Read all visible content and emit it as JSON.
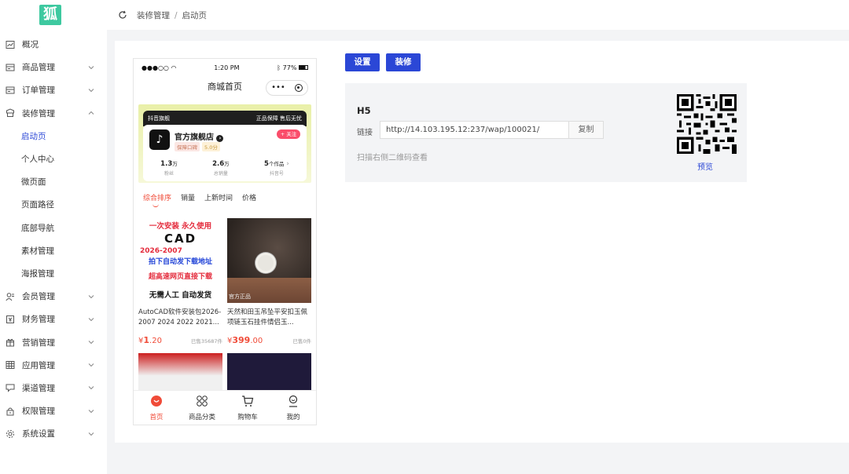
{
  "logo_text": "狐",
  "sidebar": {
    "items": [
      {
        "label": "概况",
        "icon": "chart-icon"
      },
      {
        "label": "商品管理",
        "icon": "goods-icon",
        "expandable": true
      },
      {
        "label": "订单管理",
        "icon": "order-icon",
        "expandable": true
      },
      {
        "label": "装修管理",
        "icon": "decor-icon",
        "expandable": true,
        "expanded": true
      },
      {
        "label": "启动页",
        "sub": true,
        "active": true
      },
      {
        "label": "个人中心",
        "sub": true
      },
      {
        "label": "微页面",
        "sub": true
      },
      {
        "label": "页面路径",
        "sub": true
      },
      {
        "label": "底部导航",
        "sub": true
      },
      {
        "label": "素材管理",
        "sub": true
      },
      {
        "label": "海报管理",
        "sub": true
      },
      {
        "label": "会员管理",
        "icon": "member-icon",
        "expandable": true
      },
      {
        "label": "财务管理",
        "icon": "finance-icon",
        "expandable": true
      },
      {
        "label": "营销管理",
        "icon": "gift-icon",
        "expandable": true
      },
      {
        "label": "应用管理",
        "icon": "apps-icon",
        "expandable": true
      },
      {
        "label": "渠道管理",
        "icon": "channel-icon",
        "expandable": true
      },
      {
        "label": "权限管理",
        "icon": "lock-icon",
        "expandable": true
      },
      {
        "label": "系统设置",
        "icon": "gear-icon",
        "expandable": true
      }
    ]
  },
  "breadcrumb": {
    "parent": "装修管理",
    "sep": "/",
    "current": "启动页"
  },
  "phone": {
    "status_left": "●●●○○",
    "time": "1:20 PM",
    "battery": "77%",
    "title": "商城首页",
    "capsule_dots": "•••",
    "banner_left": "抖音旗舰",
    "banner_right": "正品保障 售后无忧",
    "store_name": "官方旗舰店",
    "tag1": "保障口碑",
    "tag2": "5.0分",
    "follow": "+ 关注",
    "stats": [
      {
        "value": "1.3",
        "unit": "万",
        "label": "粉丝"
      },
      {
        "value": "2.6",
        "unit": "万",
        "label": "总销量"
      },
      {
        "value": "5",
        "unit": "个作品",
        "label": "抖音号"
      }
    ],
    "sort_tabs": [
      "综合排序",
      "销量",
      "上新时间",
      "价格"
    ],
    "goods": [
      {
        "img_lines": [
          "一次安装 永久使用",
          "CAD",
          "2026-2007",
          "拍下自动发下载地址",
          "超高速网页直接下载",
          "无需人工  自动发货"
        ],
        "title": "AutoCAD软件安装包2026-2007 2024 2022 2021...",
        "price_symbol": "¥",
        "price_int": "1",
        "price_dec": ".20",
        "sold": "已售35687件"
      },
      {
        "img_lines": [
          "官方正品"
        ],
        "title": "天然和田玉吊坠平安扣玉佩项链玉石挂件情侣玉...",
        "price_symbol": "¥",
        "price_int": "399",
        "price_dec": ".00",
        "sold": "已售0件"
      }
    ],
    "tabbar": [
      {
        "label": "首页",
        "icon": "home-icon",
        "active": true
      },
      {
        "label": "商品分类",
        "icon": "category-icon"
      },
      {
        "label": "购物车",
        "icon": "cart-icon"
      },
      {
        "label": "我的",
        "icon": "user-icon"
      }
    ]
  },
  "buttons": {
    "settings": "设置",
    "decorate": "装修"
  },
  "h5": {
    "title": "H5",
    "link_label": "链接",
    "url": "http://14.103.195.12:237/wap/100021/",
    "copy": "复制",
    "hint": "扫描右侧二维码查看",
    "preview": "预览"
  },
  "colors": {
    "accent": "#2b47d6",
    "price": "#f04b38",
    "logo": "#3ec9a0"
  }
}
